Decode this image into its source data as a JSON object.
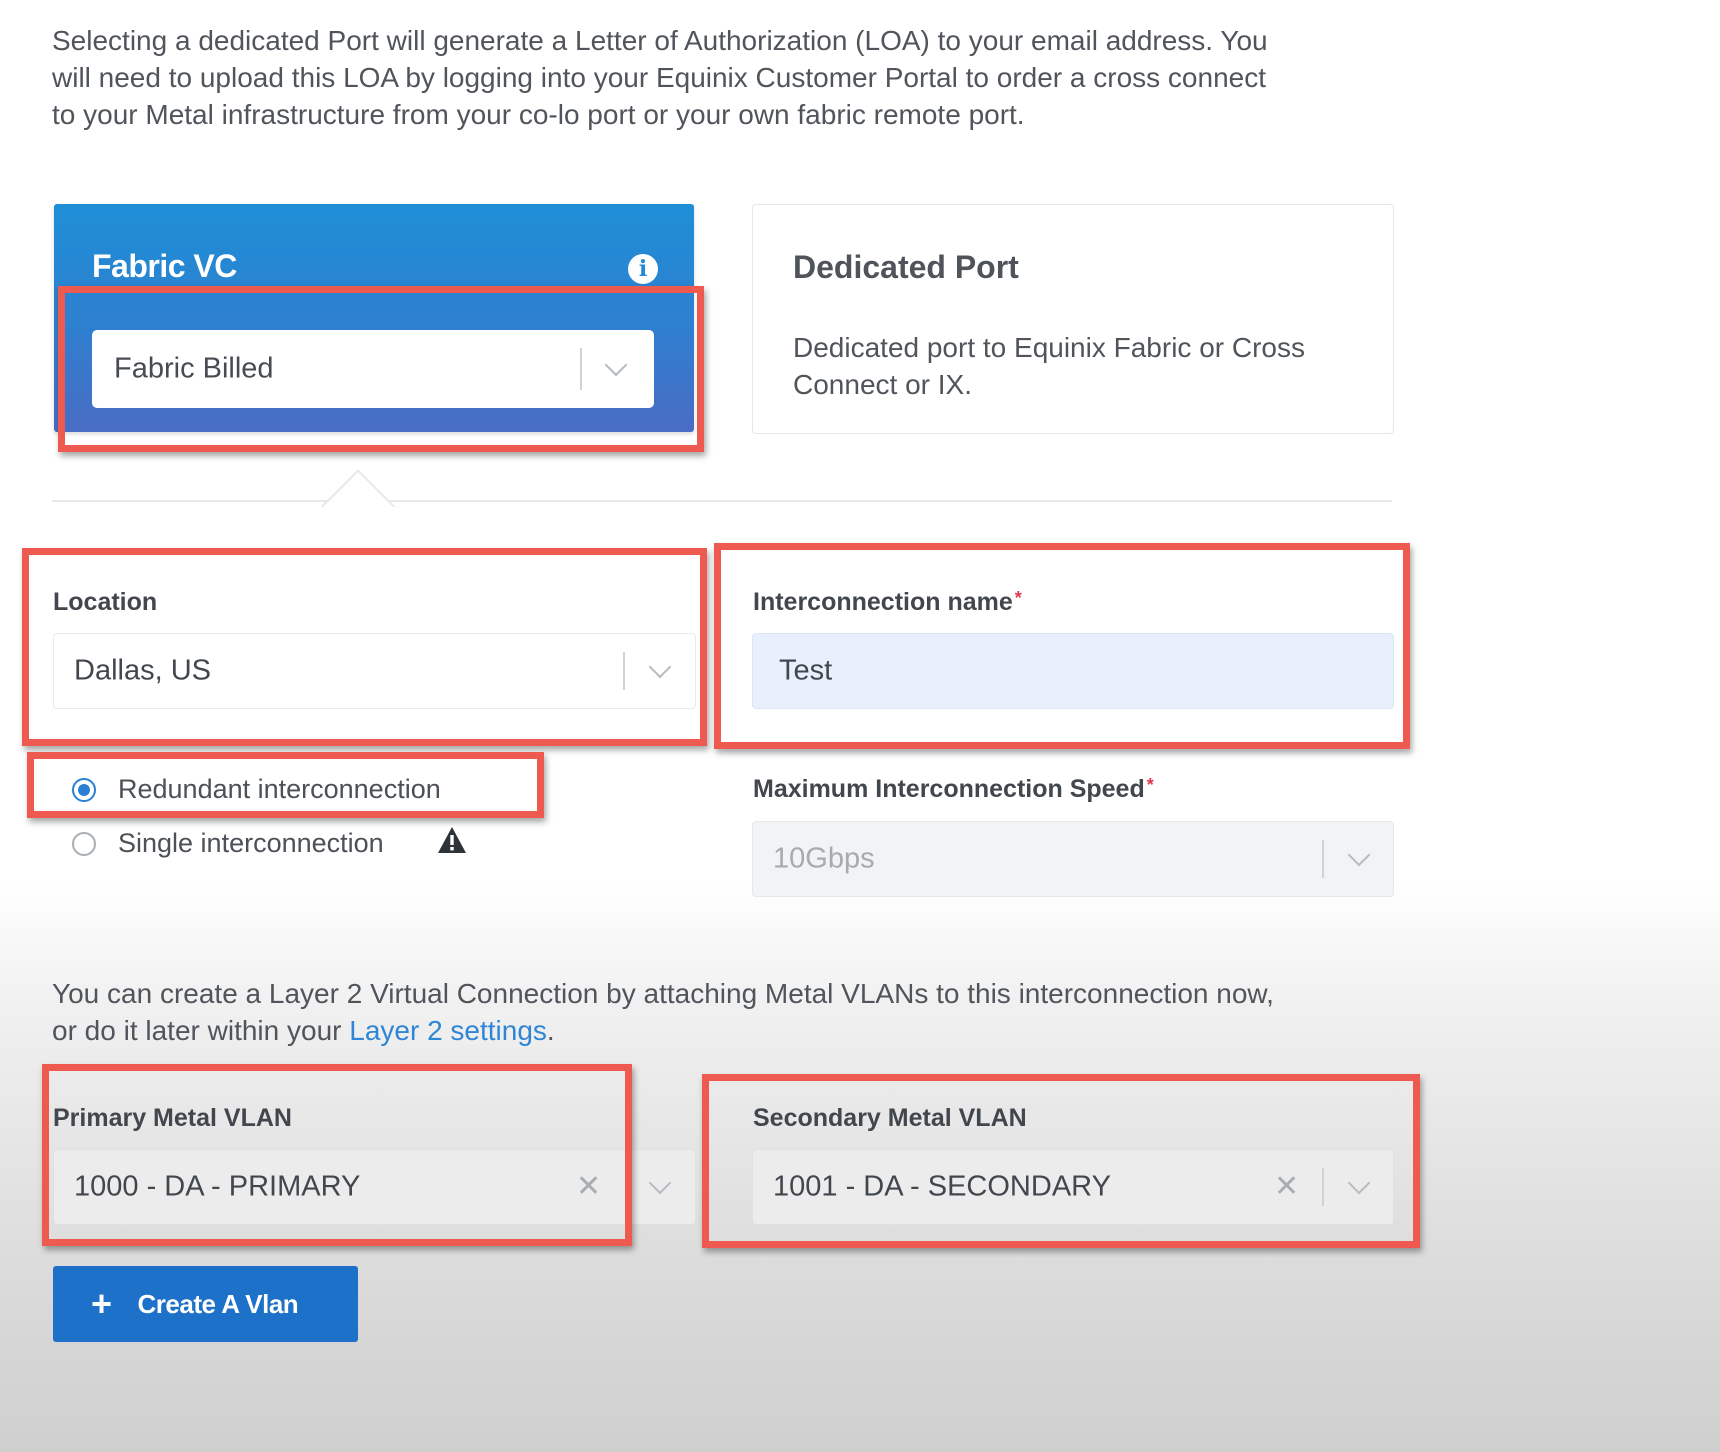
{
  "intro": {
    "line1": "Selecting a dedicated Port will generate a Letter of Authorization (LOA) to your email address. You",
    "line2": "will need to upload this LOA by logging into your Equinix Customer Portal to order a cross connect",
    "line3": "to your Metal infrastructure from your co-lo port or your own fabric remote port."
  },
  "connection_types": {
    "fabric_vc": {
      "title": "Fabric VC",
      "info_icon": "info-icon",
      "billing_select_value": "Fabric Billed",
      "selected": true
    },
    "dedicated_port": {
      "title": "Dedicated Port",
      "description_line1": "Dedicated port to Equinix Fabric or Cross",
      "description_line2": "Connect or IX.",
      "selected": false
    }
  },
  "location": {
    "label": "Location",
    "value": "Dallas, US"
  },
  "interconnection_name": {
    "label": "Interconnection name",
    "required_mark": "*",
    "value": "Test"
  },
  "redundancy": {
    "options": [
      {
        "label": "Redundant interconnection",
        "selected": true
      },
      {
        "label": "Single interconnection",
        "selected": false,
        "icon": "warning-icon"
      }
    ]
  },
  "max_speed": {
    "label": "Maximum Interconnection Speed",
    "required_mark": "*",
    "value": "10Gbps",
    "disabled": true
  },
  "layer2": {
    "text_line1": "You can create a Layer 2 Virtual Connection by attaching Metal VLANs to this interconnection now,",
    "text_line2_before": "or do it later within your ",
    "link": "Layer 2 settings",
    "text_line2_after": "."
  },
  "primary_vlan": {
    "label": "Primary Metal VLAN",
    "value": "1000 - DA - PRIMARY"
  },
  "secondary_vlan": {
    "label": "Secondary Metal VLAN",
    "value": "1001 - DA - SECONDARY"
  },
  "create_vlan_button": {
    "icon": "plus-icon",
    "label": "Create A Vlan"
  },
  "colors": {
    "accent": "#1d71c8",
    "card_blue": "#2387d2",
    "highlight": "#ef5a50",
    "required": "#e0394b",
    "link": "#2f86d6"
  }
}
